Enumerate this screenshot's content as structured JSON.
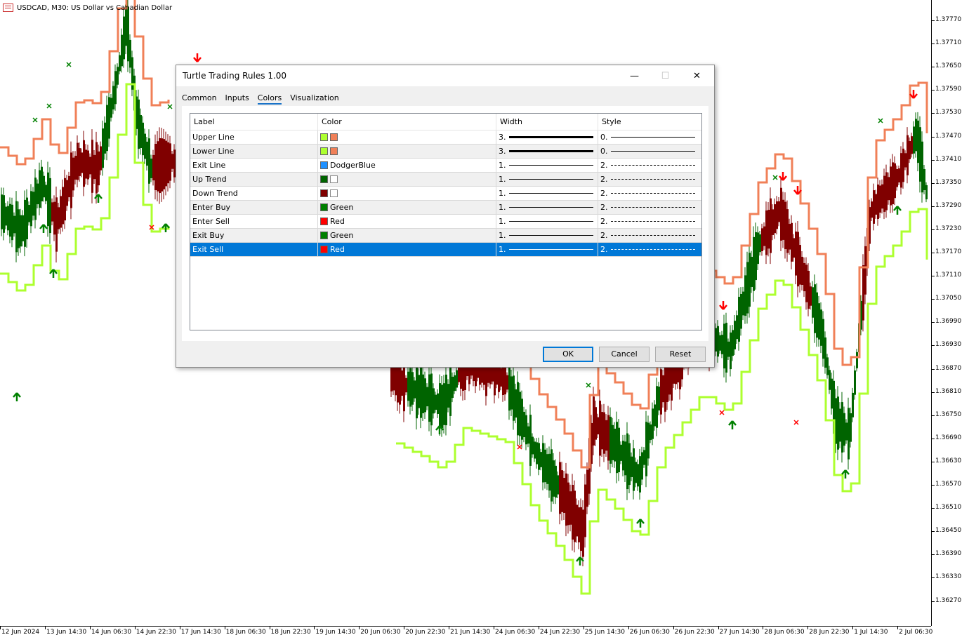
{
  "chart": {
    "symbol_title": "USDCAD, M30:  US Dollar vs Canadian Dollar",
    "price_labels": [
      "1.37770",
      "1.37710",
      "1.37650",
      "1.37590",
      "1.37530",
      "1.37470",
      "1.37410",
      "1.37350",
      "1.37290",
      "1.37230",
      "1.37170",
      "1.37110",
      "1.37050",
      "1.36990",
      "1.36930",
      "1.36870",
      "1.36810",
      "1.36750",
      "1.36690",
      "1.36630",
      "1.36570",
      "1.36510",
      "1.36450",
      "1.36390",
      "1.36330",
      "1.36270"
    ],
    "time_labels": [
      "12 Jun 2024",
      "13 Jun 14:30",
      "14 Jun 06:30",
      "14 Jun 22:30",
      "17 Jun 14:30",
      "18 Jun 06:30",
      "18 Jun 22:30",
      "19 Jun 14:30",
      "20 Jun 06:30",
      "20 Jun 22:30",
      "21 Jun 14:30",
      "24 Jun 06:30",
      "24 Jun 22:30",
      "25 Jun 14:30",
      "26 Jun 06:30",
      "26 Jun 22:30",
      "27 Jun 14:30",
      "28 Jun 06:30",
      "28 Jun 22:30",
      "1 Jul 14:30",
      "2 Jul 06:30"
    ],
    "colors": {
      "upper": "#adff2f",
      "lower": "#f08058",
      "bull": "#006400",
      "bear": "#800000",
      "buy": "#008000",
      "sell": "#ff0000",
      "exit": "#1e90ff"
    }
  },
  "dialog": {
    "title": "Turtle Trading Rules 1.00",
    "minimize_icon": "—",
    "maximize_icon": "☐",
    "close_icon": "✕",
    "tabs": [
      "Common",
      "Inputs",
      "Colors",
      "Visualization"
    ],
    "active_tab": "Colors",
    "columns": {
      "label": "Label",
      "color": "Color",
      "width": "Width",
      "style": "Style"
    },
    "rows": [
      {
        "label": "Upper Line",
        "color_name": "",
        "swatches": [
          "#adff2f",
          "#f08058"
        ],
        "width": "3.",
        "style": "0.",
        "line_weight": 3,
        "dashed": false
      },
      {
        "label": "Lower Line",
        "color_name": "",
        "swatches": [
          "#adff2f",
          "#f08058"
        ],
        "width": "3.",
        "style": "0.",
        "line_weight": 3,
        "dashed": false
      },
      {
        "label": "Exit Line",
        "color_name": "DodgerBlue",
        "swatches": [
          "#1e90ff"
        ],
        "width": "1.",
        "style": "2.",
        "line_weight": 1,
        "dashed": true
      },
      {
        "label": "Up Trend",
        "color_name": "",
        "swatches": [
          "#006400",
          "hollow"
        ],
        "width": "1.",
        "style": "2.",
        "line_weight": 1,
        "dashed": true
      },
      {
        "label": "Down Trend",
        "color_name": "",
        "swatches": [
          "#800000",
          "hollow"
        ],
        "width": "1.",
        "style": "2.",
        "line_weight": 1,
        "dashed": true
      },
      {
        "label": "Enter Buy",
        "color_name": "Green",
        "swatches": [
          "#008000"
        ],
        "width": "1.",
        "style": "2.",
        "line_weight": 1,
        "dashed": true
      },
      {
        "label": "Enter Sell",
        "color_name": "Red",
        "swatches": [
          "#ff0000"
        ],
        "width": "1.",
        "style": "2.",
        "line_weight": 1,
        "dashed": true
      },
      {
        "label": "Exit Buy",
        "color_name": "Green",
        "swatches": [
          "#008000"
        ],
        "width": "1.",
        "style": "2.",
        "line_weight": 1,
        "dashed": true
      },
      {
        "label": "Exit Sell",
        "color_name": "Red",
        "swatches": [
          "#ff0000"
        ],
        "width": "1.",
        "style": "2.",
        "line_weight": 1,
        "dashed": true,
        "selected": true
      }
    ],
    "buttons": {
      "ok": "OK",
      "cancel": "Cancel",
      "reset": "Reset"
    }
  }
}
